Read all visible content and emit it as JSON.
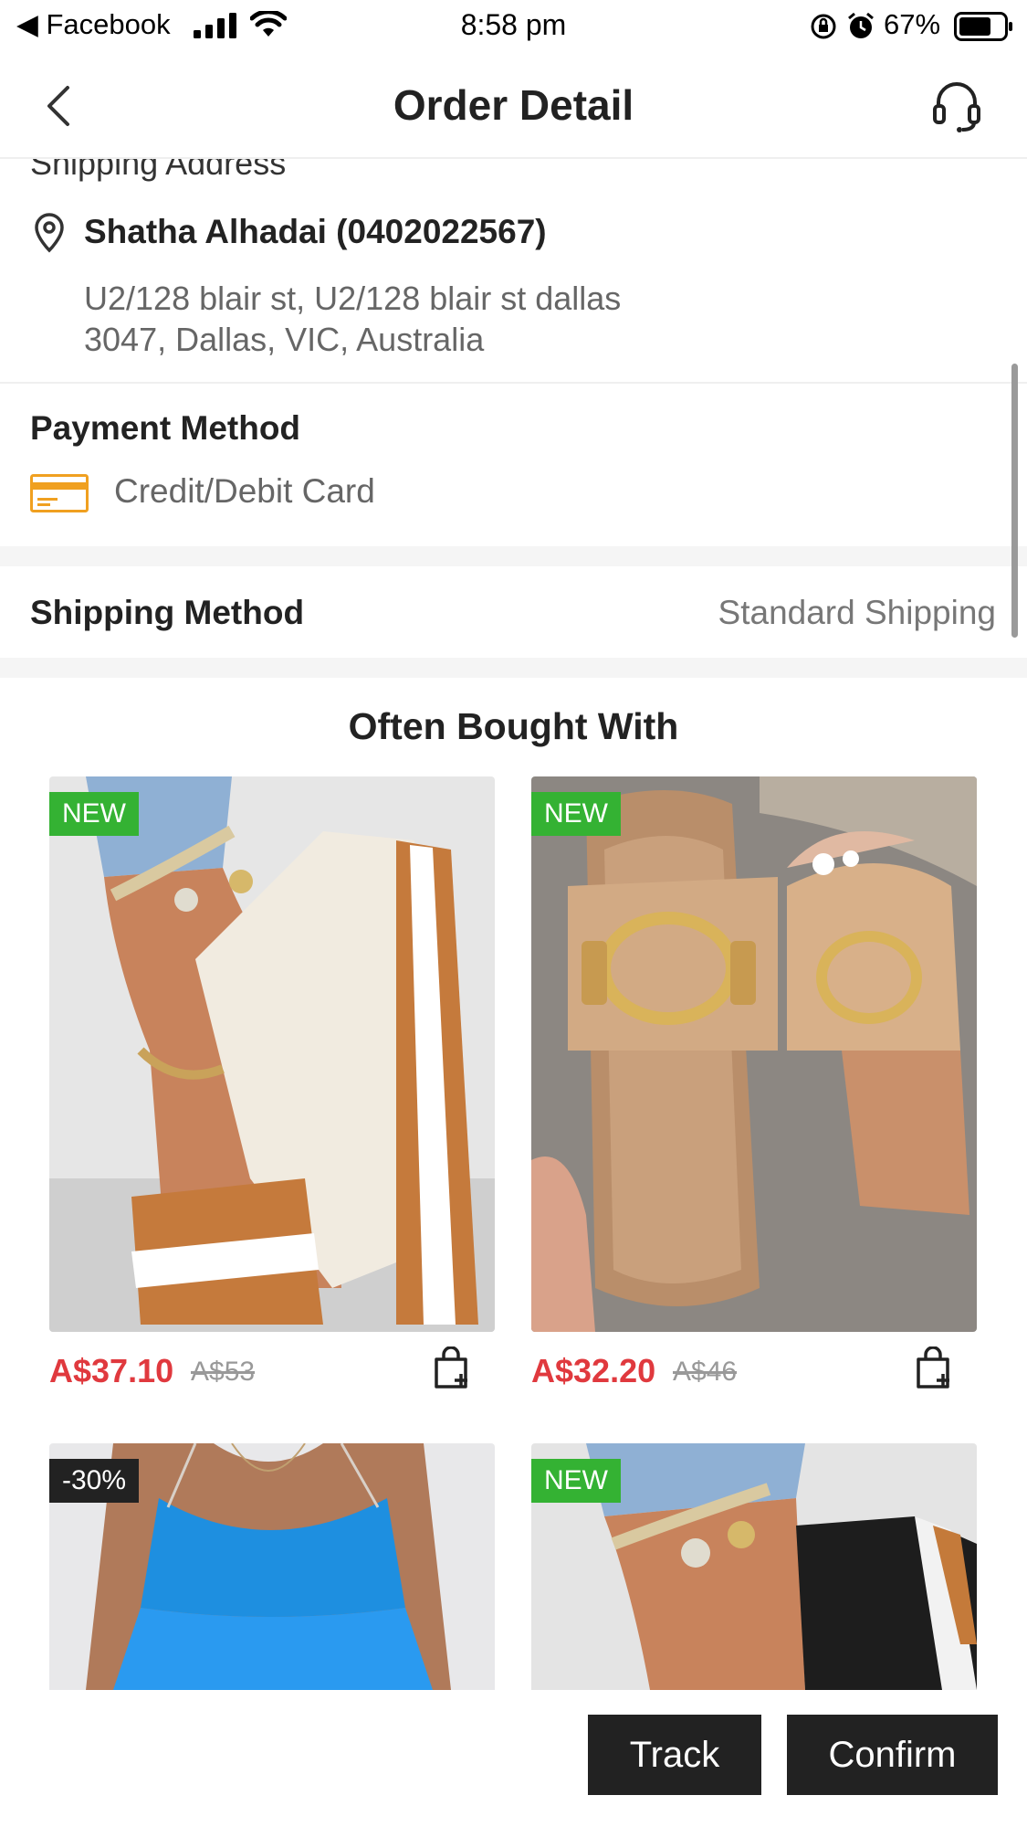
{
  "status_bar": {
    "back_app": "◀ Facebook",
    "time": "8:58 pm",
    "battery": "67%"
  },
  "nav": {
    "title": "Order Detail"
  },
  "address": {
    "heading": "Shipping Address",
    "name": "Shatha Alhadai (0402022567)",
    "line1": "U2/128 blair st, U2/128 blair st dallas",
    "line2": "3047, Dallas, VIC, Australia"
  },
  "payment": {
    "label": "Payment Method",
    "value": "Credit/Debit Card"
  },
  "shipping": {
    "label": "Shipping Method",
    "value": "Standard Shipping"
  },
  "often_bought": {
    "title": "Often Bought With",
    "products": [
      {
        "badge": "NEW",
        "price": "A$37.10",
        "old_price": "A$53"
      },
      {
        "badge": "NEW",
        "price": "A$32.20",
        "old_price": "A$46"
      },
      {
        "badge": "-30%"
      },
      {
        "badge": "NEW"
      }
    ]
  },
  "actions": {
    "track": "Track",
    "confirm": "Confirm"
  },
  "colors": {
    "accent_price": "#e0393e",
    "badge_new": "#34b233",
    "badge_discount": "#222222",
    "button_bg": "#222222"
  },
  "icons": [
    "signal-icon",
    "wifi-icon",
    "lock-rotation-icon",
    "alarm-icon",
    "battery-icon",
    "back-arrow-icon",
    "headset-icon",
    "location-pin-icon",
    "credit-card-icon",
    "add-to-cart-icon"
  ]
}
